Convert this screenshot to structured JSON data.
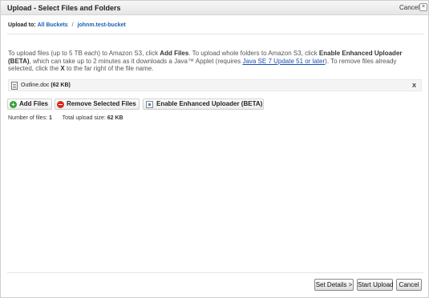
{
  "dialog": {
    "title": "Upload - Select Files and Folders",
    "cancel_label": "Cancel",
    "close_glyph": "×"
  },
  "breadcrumb": {
    "label": "Upload to:",
    "items": [
      "All Buckets",
      "johnm.test-bucket"
    ],
    "separator": "/"
  },
  "instructions": {
    "part1": "To upload files (up to 5 TB each) to Amazon S3, click ",
    "add_files": "Add Files",
    "part2": ". To upload whole folders to Amazon S3, click ",
    "enhanced": "Enable Enhanced Uploader (BETA)",
    "part3": ", which can take up to 2 minutes as it downloads a Java™ Applet (requires ",
    "java_link": "Java SE 7 Update 51 or later",
    "part4": "). To remove files already selected, click the ",
    "x_label": "X",
    "part5": " to the far right of the file name."
  },
  "files": [
    {
      "name": "Outline.doc",
      "size": "(62 KB)",
      "icon": "document-icon",
      "remove_label": "X"
    }
  ],
  "toolbar": {
    "add_files": "Add Files",
    "remove_selected": "Remove Selected Files",
    "enable_enhanced": "Enable Enhanced Uploader (BETA)",
    "icons": [
      "add-icon",
      "remove-icon",
      "applet-icon"
    ]
  },
  "stats": {
    "file_count_label": "Number of files:",
    "file_count": "1",
    "total_size_label": "Total upload size:",
    "total_size": "62 KB"
  },
  "footer": {
    "set_details": "Set Details >",
    "start_upload": "Start Upload",
    "cancel": "Cancel"
  },
  "colors": {
    "link": "#1a5fb4",
    "add_icon": "#34a334",
    "remove_icon": "#d82a1c"
  }
}
